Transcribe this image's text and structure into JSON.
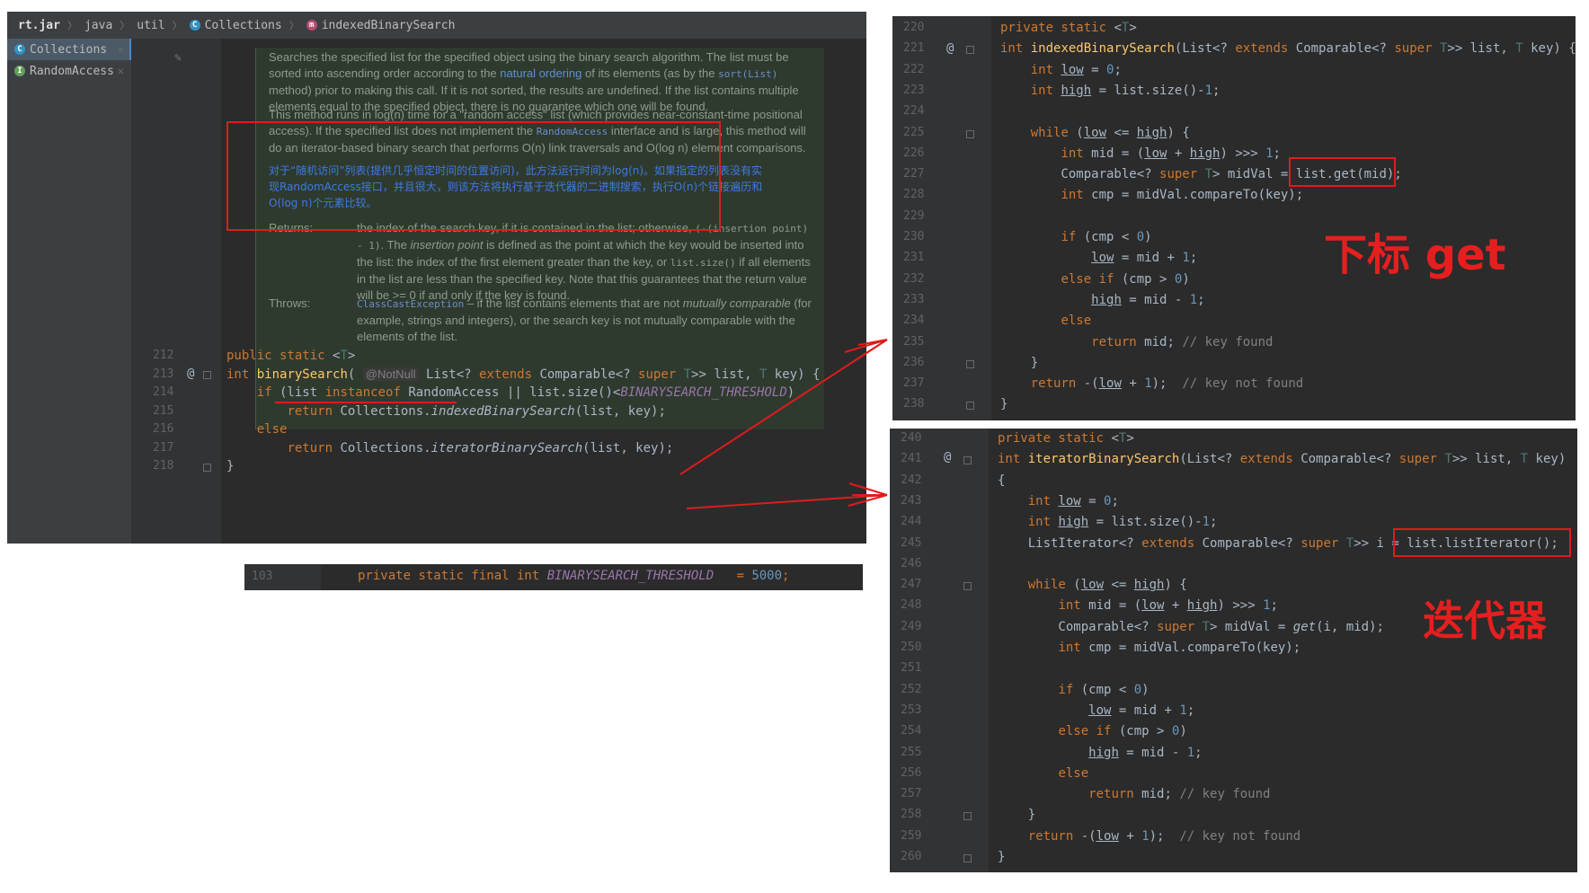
{
  "breadcrumb": {
    "items": [
      "rt.jar",
      "java",
      "util",
      "Collections",
      "indexedBinarySearch"
    ]
  },
  "sidebar": {
    "items": [
      {
        "label": "Collections"
      },
      {
        "label": "RandomAccess"
      }
    ]
  },
  "javadoc": {
    "para1": "Searches the specified list for the specified object using the binary search algorithm. The list must be sorted into ascending order according to the",
    "natural_ordering": "natural ordering",
    "para1b": "of its elements (as by the",
    "sort_code": "sort(List)",
    "para1c": "method) prior to making this call. If it is not sorted, the results are undefined. If the list contains multiple elements equal to the specified object, there is no guarantee which one will be found.",
    "para2a": "This method runs in log(n) time for a \"random access\" list (which provides near-constant-time positional access). If the specified list does not implement the",
    "random_access_code": "RandomAccess",
    "para2b": "interface and is large, this method will do an iterator-based binary search that performs O(n) link traversals and O(log n) element comparisons.",
    "cn_translation": "对于“随机访问”列表(提供几乎恒定时间的位置访问)，此方法运行时间为log(n)。如果指定的列表没有实现RandomAccess接口，并且很大，则该方法将执行基于迭代器的二进制搜索，执行O(n)个链接遍历和O(log n)个元素比较。",
    "returns_label": "Returns:",
    "returns_text_a": "the index of the search key, if it is contained in the list; otherwise,",
    "returns_code": "(-(insertion point) - 1)",
    "returns_text_b": ". The",
    "insertion_point": "insertion point",
    "returns_text_c": "is defined as the point at which the key would be inserted into the list: the index of the first element greater than the key, or",
    "list_size_code": "list.size()",
    "returns_text_d": "if all elements in the list are less than the specified key. Note that this guarantees that the return value will be >= 0 if and only if the key is found.",
    "throws_label": "Throws:",
    "throws_code": "ClassCastException",
    "throws_text_a": "– if the list contains elements that are not",
    "mutually_comparable": "mutually comparable",
    "throws_text_b": "(for example, strings and integers), or the search key is not mutually comparable with the elements of the list."
  },
  "left_code": {
    "line_numbers": [
      "212",
      "213",
      "214",
      "215",
      "216",
      "217",
      "218"
    ],
    "annotation": "@NotNull"
  },
  "threshold": {
    "line": "103",
    "code": "private static final int BINARYSEARCH_THRESHOLD   = 5000;"
  },
  "right_top": {
    "line_numbers": [
      "220",
      "221",
      "222",
      "223",
      "224",
      "225",
      "226",
      "227",
      "228",
      "229",
      "230",
      "231",
      "232",
      "233",
      "234",
      "235",
      "236",
      "237",
      "238"
    ],
    "label": "下标 get"
  },
  "right_bottom": {
    "line_numbers": [
      "240",
      "241",
      "242",
      "243",
      "244",
      "245",
      "246",
      "247",
      "248",
      "249",
      "250",
      "251",
      "252",
      "253",
      "254",
      "255",
      "256",
      "257",
      "258",
      "259",
      "260"
    ],
    "label": "迭代器"
  },
  "colors": {
    "accent_red": "#e01b1b",
    "editor_bg": "#2b2b2b",
    "keyword": "#cc7832"
  }
}
